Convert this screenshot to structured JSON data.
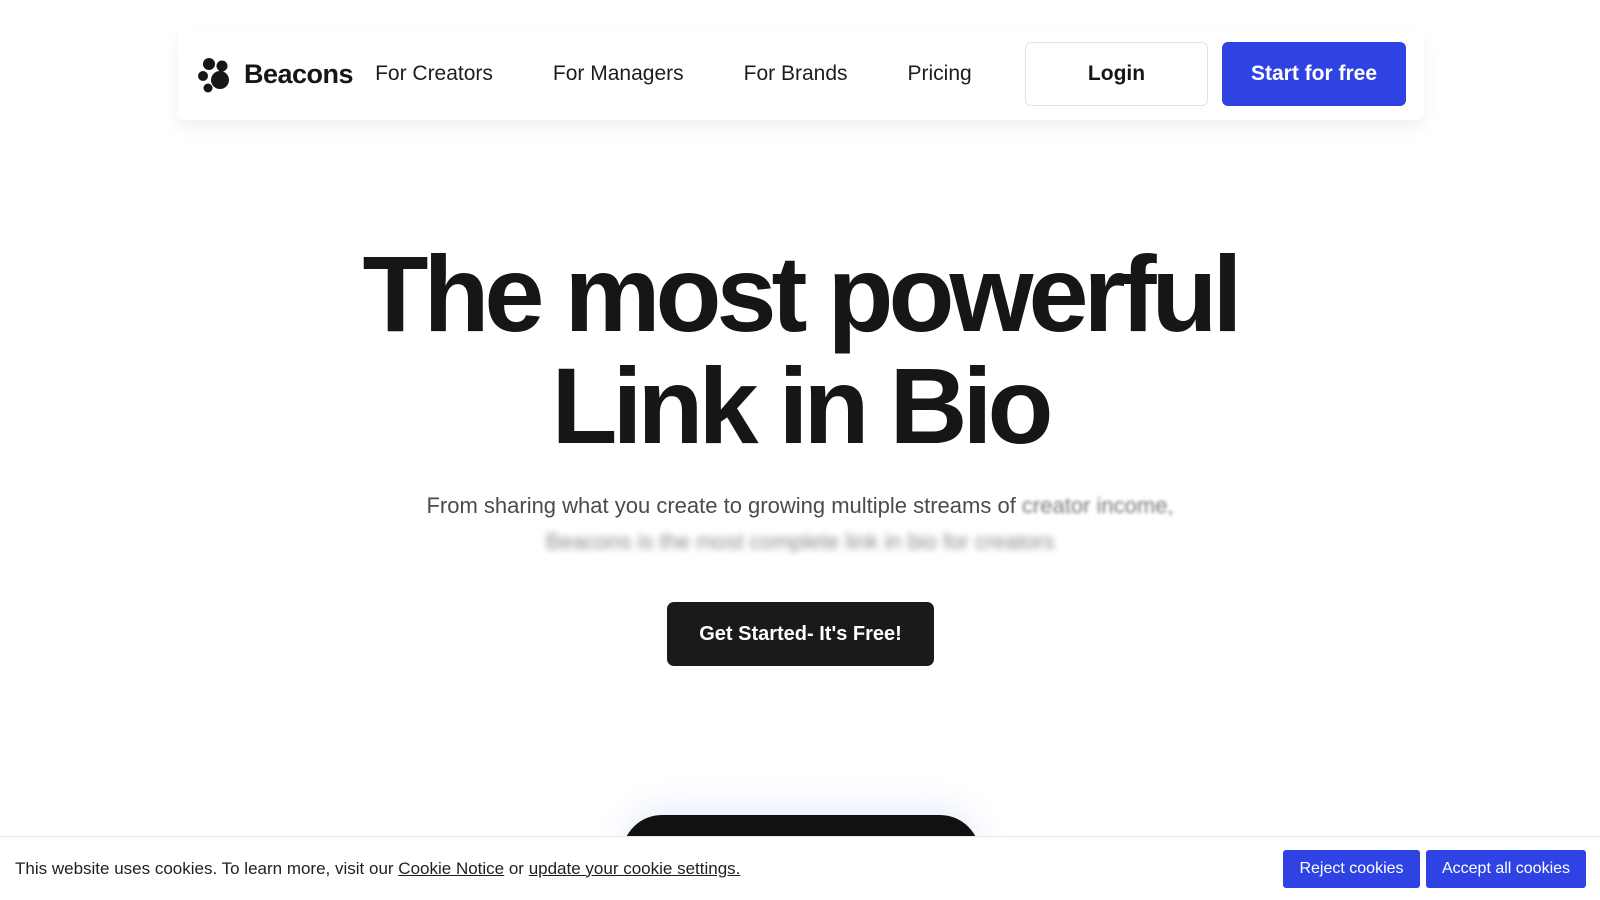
{
  "brand": {
    "name": "Beacons",
    "accent_color": "#2f43e4",
    "logo_icon": "paw-dots-icon"
  },
  "nav": {
    "links": [
      "For Creators",
      "For Managers",
      "For Brands",
      "Pricing"
    ],
    "login_label": "Login",
    "start_label": "Start for free"
  },
  "hero": {
    "title_line1": "The most powerful",
    "title_line2": "Link in Bio",
    "subtitle_line1_a": "From sharing what you create to growing multiple streams of",
    "subtitle_line1_b": " creator income,",
    "subtitle_line2": "Beacons is the most complete link in bio for creators",
    "cta_label": "Get Started- It's Free!"
  },
  "cookie": {
    "text_prefix": "This website uses cookies. To learn more, visit our ",
    "notice_link": "Cookie Notice",
    "text_mid": " or ",
    "settings_link": "update your cookie settings.",
    "reject_label": "Reject cookies",
    "accept_label": "Accept all cookies"
  }
}
